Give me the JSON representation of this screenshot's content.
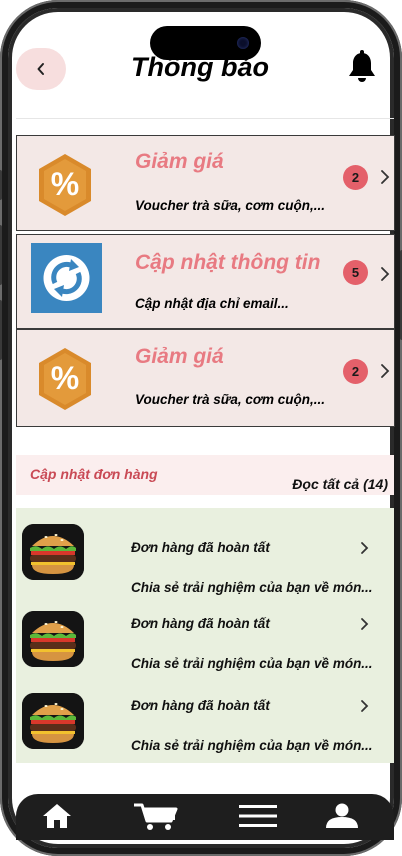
{
  "header": {
    "title": "Thông báo",
    "back_icon": "chevron-left-icon",
    "bell_icon": "bell-icon"
  },
  "notifications": [
    {
      "icon": "percent-icon",
      "title": "Giảm giá",
      "description": "Voucher trà sữa, cơm cuộn,...",
      "badge": "2"
    },
    {
      "icon": "sync-icon",
      "title": "Cập nhật thông tin",
      "description": "Cập nhật  địa chỉ email...",
      "badge": "5"
    },
    {
      "icon": "percent-icon",
      "title": "Giảm giá",
      "description": "Voucher trà sữa, cơm cuộn,...",
      "badge": "2"
    }
  ],
  "orders_section": {
    "title": "Cập nhật đơn hàng",
    "read_all": "Đọc tất cả (14)"
  },
  "orders": [
    {
      "image": "burger-image",
      "title": "Đơn hàng đã hoàn tất",
      "description": "Chia sẻ trải nghiệm của bạn về món..."
    },
    {
      "image": "burger-image",
      "title": "Đơn hàng đã hoàn tất",
      "description": "Chia sẻ trải nghiệm của bạn về món..."
    },
    {
      "image": "burger-image",
      "title": "Đơn hàng đã hoàn tất",
      "description": "Chia sẻ trải nghiệm của bạn về món..."
    }
  ],
  "tabbar": {
    "items": [
      "home-icon",
      "cart-icon",
      "menu-icon",
      "user-icon"
    ]
  },
  "colors": {
    "accent": "#e87a82",
    "badge": "#e4606a",
    "card_bg": "#f3e8e6",
    "orders_bg": "#e9f0df",
    "section_title": "#c94a55"
  }
}
